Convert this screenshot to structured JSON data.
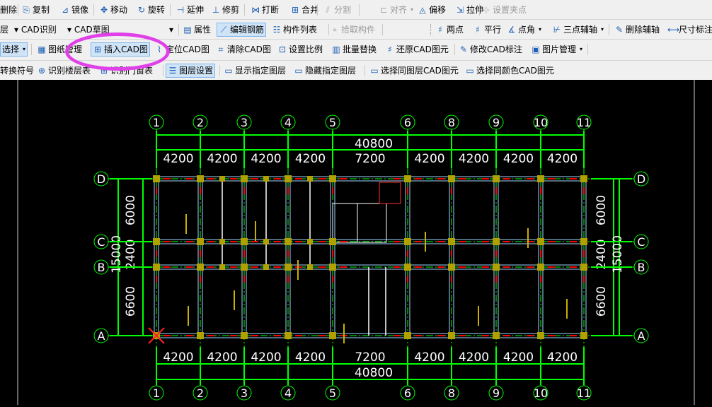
{
  "toolbar": {
    "row1": [
      {
        "label": "删除",
        "icon": "delete-icon",
        "glyph": ""
      },
      {
        "label": "复制",
        "icon": "copy-icon",
        "glyph": "⎘"
      },
      {
        "label": "镜像",
        "icon": "mirror-icon",
        "glyph": "⊿"
      },
      {
        "label": "移动",
        "icon": "move-icon",
        "glyph": "✥"
      },
      {
        "label": "旋转",
        "icon": "rotate-icon",
        "glyph": "↻"
      },
      {
        "label": "延伸",
        "icon": "extend-icon",
        "glyph": "⊣"
      },
      {
        "label": "修剪",
        "icon": "trim-icon",
        "glyph": "⊥"
      },
      {
        "label": "打断",
        "icon": "break-icon",
        "glyph": "⋈"
      },
      {
        "label": "合并",
        "icon": "merge-icon",
        "glyph": "⊞"
      },
      {
        "label": "分割",
        "icon": "split-icon",
        "glyph": "⫽",
        "disabled": true
      },
      {
        "label": "对齐",
        "icon": "align-icon",
        "glyph": "⊏",
        "disabled": true,
        "dropdown": true
      },
      {
        "label": "偏移",
        "icon": "offset-icon",
        "glyph": "◬"
      },
      {
        "label": "拉伸",
        "icon": "stretch-icon",
        "glyph": "⇲"
      },
      {
        "label": "设置夹点",
        "icon": "grip-point-icon",
        "glyph": "⊹",
        "disabled": true
      }
    ],
    "row2": {
      "layer_label": "层",
      "recognize_select": "CAD识别",
      "cad_select": "CAD草图",
      "items": [
        {
          "label": "属性",
          "icon": "properties-icon",
          "glyph": "▤"
        },
        {
          "label": "编辑钢筋",
          "icon": "edit-rebar-icon",
          "glyph": "⟋",
          "active": true
        },
        {
          "label": "构件列表",
          "icon": "component-list-icon",
          "glyph": "☷"
        },
        {
          "label": "拾取构件",
          "icon": "pick-component-icon",
          "glyph": "⌖",
          "disabled": true
        },
        {
          "label": "两点",
          "icon": "two-point-icon",
          "glyph": "♯"
        },
        {
          "label": "平行",
          "icon": "parallel-icon",
          "glyph": "♯"
        },
        {
          "label": "点角",
          "icon": "point-angle-icon",
          "glyph": "∡",
          "dropdown": true
        },
        {
          "label": "三点辅轴",
          "icon": "three-point-axis-icon",
          "glyph": "⊬",
          "dropdown": true
        },
        {
          "label": "删除辅轴",
          "icon": "delete-axis-icon",
          "glyph": "✎"
        },
        {
          "label": "尺寸标注",
          "icon": "dimension-icon",
          "glyph": "⟷"
        }
      ]
    },
    "row3": {
      "select_label": "选择",
      "items": [
        {
          "label": "图纸管理",
          "icon": "drawing-manage-icon",
          "glyph": "▦"
        },
        {
          "label": "插入CAD图",
          "icon": "insert-cad-icon",
          "glyph": "⊞",
          "active": true
        },
        {
          "label": "定位CAD图",
          "icon": "locate-cad-icon",
          "glyph": "⌇"
        },
        {
          "label": "清除CAD图",
          "icon": "clear-cad-icon",
          "glyph": "⌗"
        },
        {
          "label": "设置比例",
          "icon": "set-scale-icon",
          "glyph": "⊡"
        },
        {
          "label": "批量替换",
          "icon": "batch-replace-icon",
          "glyph": "▥"
        },
        {
          "label": "还原CAD图元",
          "icon": "restore-cad-icon",
          "glyph": "♯"
        },
        {
          "label": "修改CAD标注",
          "icon": "modify-cad-annotation-icon",
          "glyph": "✎"
        },
        {
          "label": "图片管理",
          "icon": "image-manage-icon",
          "glyph": "▣",
          "dropdown": true
        }
      ]
    },
    "row4": [
      {
        "label": "转换符号",
        "icon": "convert-symbol-icon",
        "glyph": ""
      },
      {
        "label": "识别楼层表",
        "icon": "recognize-floor-table-icon",
        "glyph": "⊕"
      },
      {
        "label": "识别门窗表",
        "icon": "recognize-door-window-icon",
        "glyph": "⊞"
      },
      {
        "label": "图层设置",
        "icon": "layer-settings-icon",
        "glyph": "☰",
        "active": true
      },
      {
        "label": "显示指定图层",
        "icon": "show-layer-icon",
        "glyph": "▭"
      },
      {
        "label": "隐藏指定图层",
        "icon": "hide-layer-icon",
        "glyph": "▭"
      },
      {
        "label": "选择同图层CAD图元",
        "icon": "select-same-layer-icon",
        "glyph": "▭"
      },
      {
        "label": "选择同颜色CAD图元",
        "icon": "select-same-color-icon",
        "glyph": "▭"
      }
    ]
  },
  "drawing": {
    "axes_top": [
      "1",
      "2",
      "3",
      "4",
      "5",
      "6",
      "8",
      "9",
      "10",
      "11"
    ],
    "axes_side": [
      "D",
      "C",
      "B",
      "A"
    ],
    "spans": [
      "4200",
      "4200",
      "4200",
      "4200",
      "7200",
      "4200",
      "4200",
      "4200",
      "4200"
    ],
    "total_length": "40800",
    "left_dims": [
      "6000",
      "2400",
      "6600"
    ],
    "total_depth": "15000",
    "colors": {
      "axis": "#00ff00",
      "wall": "#ffffff",
      "dim": "#00ff00",
      "column": "#b0a000",
      "rebar": "#ff0000",
      "marker": "#ff2020",
      "background": "#000000"
    }
  }
}
